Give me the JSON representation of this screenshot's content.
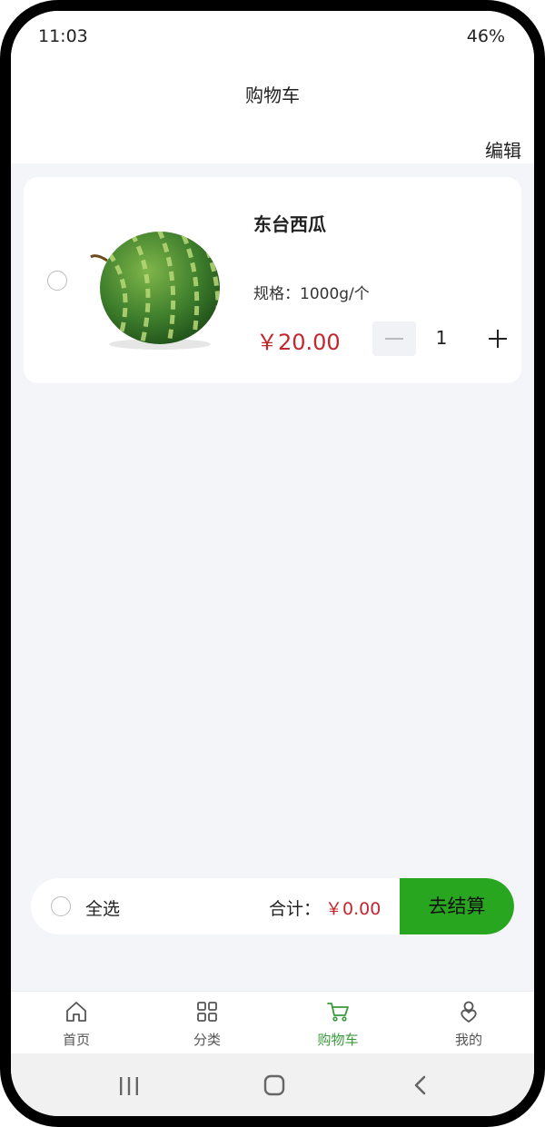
{
  "status_bar": {
    "time": "11:03",
    "battery": "46%"
  },
  "header": {
    "title": "购物车"
  },
  "toolbar": {
    "edit_label": "编辑"
  },
  "cart": {
    "items": [
      {
        "name": "东台西瓜",
        "spec": "规格：1000g/个",
        "price": "￥20.00",
        "quantity": "1",
        "selected": false
      }
    ]
  },
  "checkout_bar": {
    "select_all_label": "全选",
    "total_label": "合计：",
    "total_value": "￥0.00",
    "checkout_label": "去结算"
  },
  "tabbar": {
    "items": [
      {
        "label": "首页",
        "icon": "home-icon"
      },
      {
        "label": "分类",
        "icon": "grid-icon"
      },
      {
        "label": "购物车",
        "icon": "cart-icon"
      },
      {
        "label": "我的",
        "icon": "user-icon"
      }
    ],
    "active_index": 2
  },
  "colors": {
    "accent": "#29a620",
    "price": "#c4262e",
    "tab_active": "#3a9a3a"
  }
}
